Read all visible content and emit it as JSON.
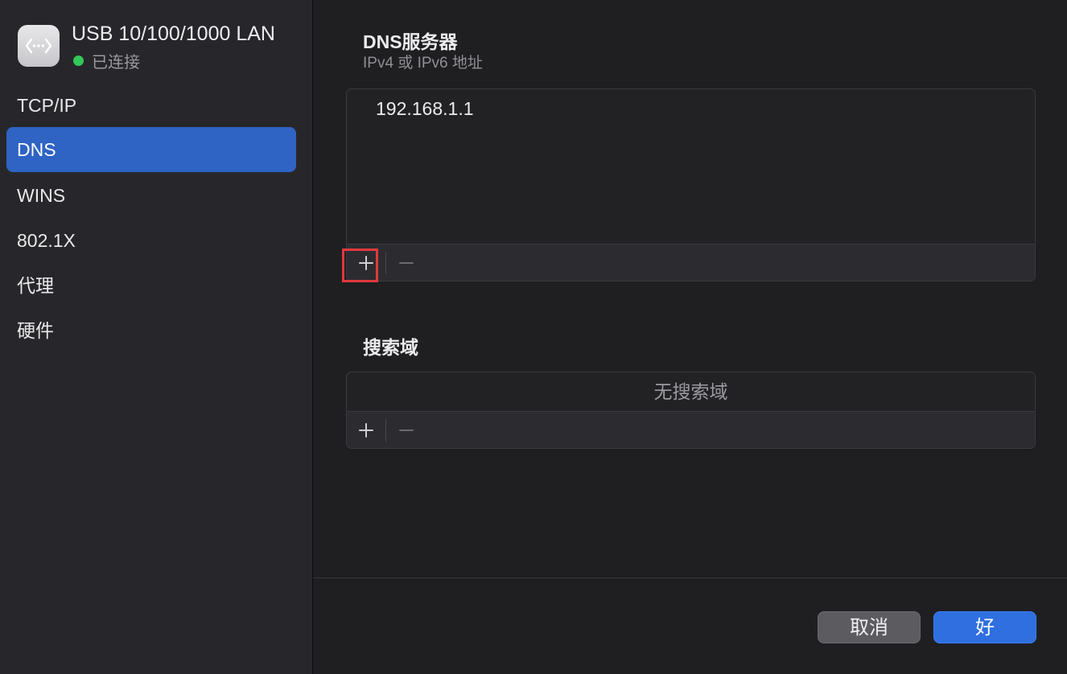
{
  "sidebar": {
    "interface_name": "USB 10/100/1000 LAN",
    "status_text": "已连接",
    "status_color": "#34c759",
    "icon": "ethernet-icon",
    "items": [
      {
        "label": "TCP/IP",
        "selected": false
      },
      {
        "label": "DNS",
        "selected": true
      },
      {
        "label": "WINS",
        "selected": false
      },
      {
        "label": "802.1X",
        "selected": false
      },
      {
        "label": "代理",
        "selected": false
      },
      {
        "label": "硬件",
        "selected": false
      }
    ]
  },
  "dns": {
    "title": "DNS服务器",
    "subtitle": "IPv4 或 IPv6 地址",
    "servers": [
      "192.168.1.1"
    ],
    "add_icon": "plus-icon",
    "remove_icon": "minus-icon"
  },
  "search": {
    "title": "搜索域",
    "empty_text": "无搜索域",
    "add_icon": "plus-icon",
    "remove_icon": "minus-icon"
  },
  "footer": {
    "cancel_label": "取消",
    "ok_label": "好"
  },
  "colors": {
    "accent": "#2f63c4",
    "ok_button": "#2f6fe0",
    "highlight": "#e0393e"
  }
}
